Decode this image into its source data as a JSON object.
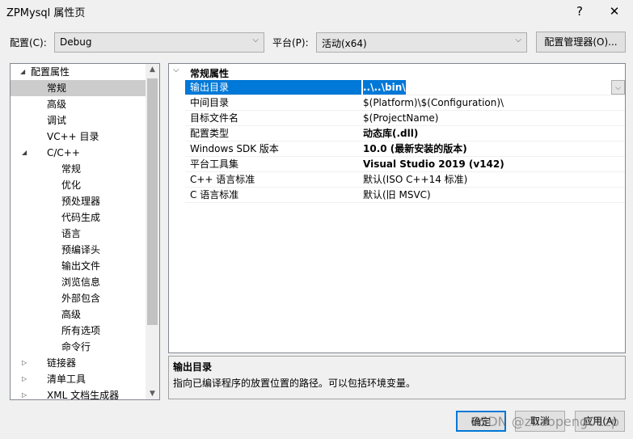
{
  "window": {
    "title": "ZPMysql 属性页",
    "help": "?",
    "close": "✕"
  },
  "config": {
    "label": "配置(C):",
    "value": "Debug",
    "platform_label": "平台(P):",
    "platform_value": "活动(x64)",
    "manager_button": "配置管理器(O)..."
  },
  "tree": [
    {
      "label": "配置属性",
      "level": 0,
      "expander": "◢"
    },
    {
      "label": "常规",
      "level": 1,
      "selected": true
    },
    {
      "label": "高级",
      "level": 1
    },
    {
      "label": "调试",
      "level": 1
    },
    {
      "label": "VC++ 目录",
      "level": 1
    },
    {
      "label": "C/C++",
      "level": 1,
      "expander": "◢"
    },
    {
      "label": "常规",
      "level": 2
    },
    {
      "label": "优化",
      "level": 2
    },
    {
      "label": "预处理器",
      "level": 2
    },
    {
      "label": "代码生成",
      "level": 2
    },
    {
      "label": "语言",
      "level": 2
    },
    {
      "label": "预编译头",
      "level": 2
    },
    {
      "label": "输出文件",
      "level": 2
    },
    {
      "label": "浏览信息",
      "level": 2
    },
    {
      "label": "外部包含",
      "level": 2
    },
    {
      "label": "高级",
      "level": 2
    },
    {
      "label": "所有选项",
      "level": 2
    },
    {
      "label": "命令行",
      "level": 2
    },
    {
      "label": "链接器",
      "level": 1,
      "expander": "▷"
    },
    {
      "label": "清单工具",
      "level": 1,
      "expander": "▷"
    },
    {
      "label": "XML 文档生成器",
      "level": 1,
      "expander": "▷"
    }
  ],
  "grid": {
    "section": "常规属性",
    "rows": [
      {
        "name": "输出目录",
        "value": "..\\..\\bin\\",
        "selected": true
      },
      {
        "name": "中间目录",
        "value": "$(Platform)\\$(Configuration)\\"
      },
      {
        "name": "目标文件名",
        "value": "$(ProjectName)"
      },
      {
        "name": "配置类型",
        "value": "动态库(.dll)",
        "bold": true
      },
      {
        "name": "Windows SDK 版本",
        "value": "10.0 (最新安装的版本)",
        "bold": true
      },
      {
        "name": "平台工具集",
        "value": "Visual Studio 2019 (v142)",
        "bold": true
      },
      {
        "name": "C++ 语言标准",
        "value": "默认(ISO C++14 标准)"
      },
      {
        "name": "C 语言标准",
        "value": "默认(旧 MSVC)"
      }
    ]
  },
  "description": {
    "title": "输出目录",
    "text": "指向已编译程序的放置位置的路径。可以包括环境变量。"
  },
  "buttons": {
    "ok": "确定",
    "cancel": "取消",
    "apply": "应用(A)"
  },
  "watermark": "CSDN @zhaopeng01zp"
}
